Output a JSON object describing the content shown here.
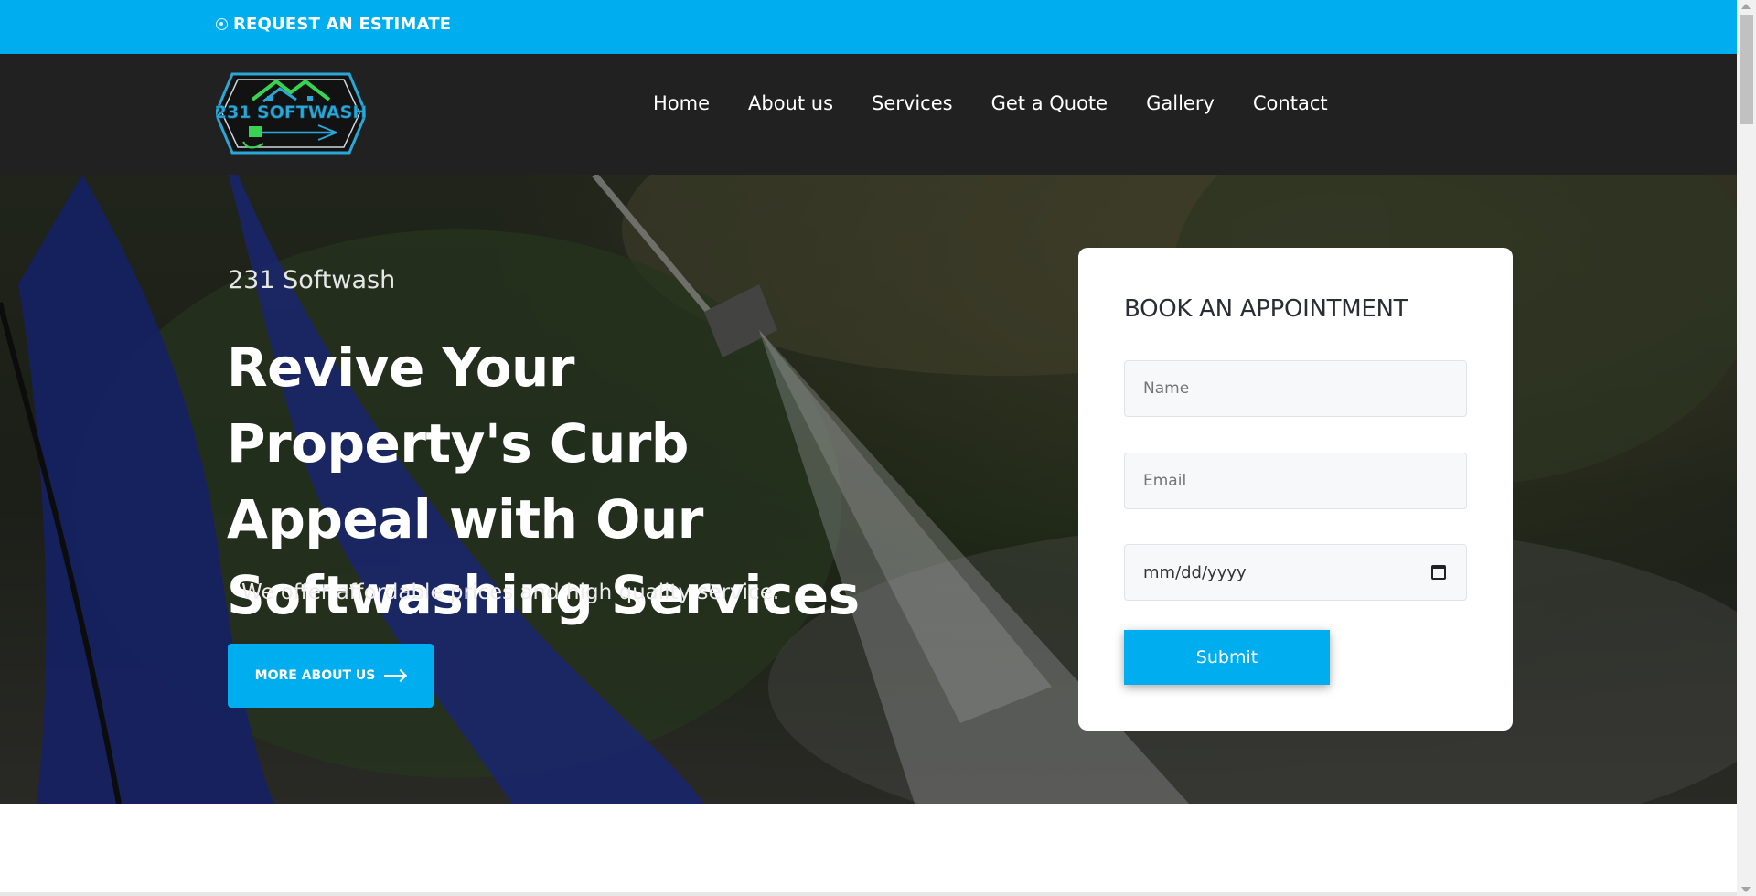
{
  "topbar": {
    "request_label": "REQUEST AN ESTIMATE",
    "bg_color": "#00aeef"
  },
  "brand": {
    "logo_text": "231 SOFTWASH",
    "logo_icon": "house-roof-pressure-washer-logo"
  },
  "nav": {
    "items": [
      {
        "label": "Home"
      },
      {
        "label": "About us"
      },
      {
        "label": "Services"
      },
      {
        "label": "Get a Quote"
      },
      {
        "label": "Gallery"
      },
      {
        "label": "Contact"
      }
    ]
  },
  "hero": {
    "kicker": "231 Softwash",
    "title": "Revive Your Property's Curb Appeal with Our Softwashing Services",
    "subtitle": "We offer affordable prices and high quality service.",
    "button_label": "MORE ABOUT US",
    "button_icon": "arrow-right-icon"
  },
  "booking": {
    "title": "BOOK AN APPOINTMENT",
    "name_placeholder": "Name",
    "email_placeholder": "Email",
    "date_placeholder": "mm/dd/yyyy",
    "date_icon": "calendar-icon",
    "submit_label": "Submit"
  },
  "colors": {
    "accent": "#00aeef",
    "nav_bg": "#212121",
    "card_title": "#2b2d34"
  }
}
